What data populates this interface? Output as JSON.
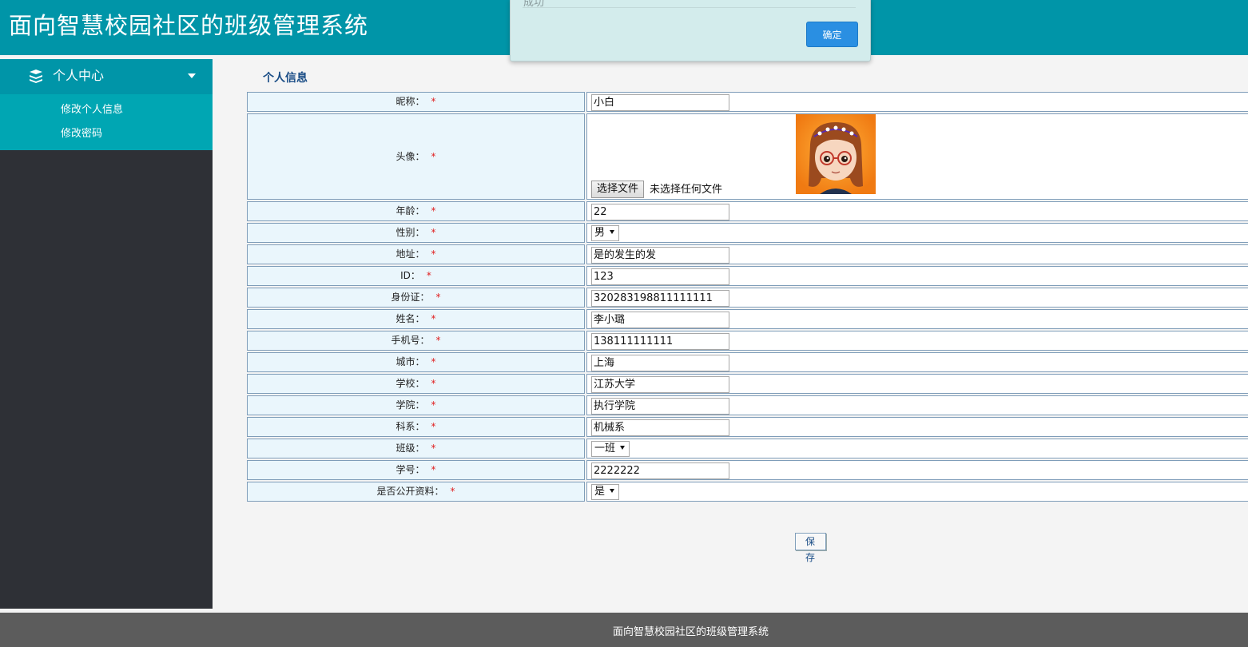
{
  "header": {
    "title": "面向智慧校园社区的班级管理系统"
  },
  "dialog": {
    "message": "成功",
    "ok_label": "确定"
  },
  "sidebar": {
    "menu_title": "个人中心",
    "items": [
      {
        "label": "修改个人信息"
      },
      {
        "label": "修改密码"
      }
    ]
  },
  "main": {
    "section_title": "个人信息",
    "required_mark": "*",
    "fields": {
      "nickname": {
        "label": "昵称：",
        "value": "小白"
      },
      "avatar": {
        "label": "头像：",
        "file_button": "选择文件",
        "file_status": "未选择任何文件"
      },
      "age": {
        "label": "年龄：",
        "value": "22"
      },
      "gender": {
        "label": "性别：",
        "value": "男"
      },
      "address": {
        "label": "地址：",
        "value": "是的发生的发"
      },
      "id": {
        "label": "ID：",
        "value": "123"
      },
      "id_card": {
        "label": "身份证：",
        "value": "320283198811111111"
      },
      "name": {
        "label": "姓名：",
        "value": "李小璐"
      },
      "phone": {
        "label": "手机号：",
        "value": "138111111111"
      },
      "city": {
        "label": "城市：",
        "value": "上海"
      },
      "school": {
        "label": "学校：",
        "value": "江苏大学"
      },
      "college": {
        "label": "学院：",
        "value": "执行学院"
      },
      "department": {
        "label": "科系：",
        "value": "机械系"
      },
      "class": {
        "label": "班级：",
        "value": "一班"
      },
      "student_no": {
        "label": "学号：",
        "value": "2222222"
      },
      "public_profile": {
        "label": "是否公开资料：",
        "value": "是"
      }
    },
    "save_label": "保 存"
  },
  "footer": {
    "text": "面向智慧校园社区的班级管理系统"
  },
  "colors": {
    "header_bg": "#0095a8",
    "sidebar_bg": "#2e3036",
    "submenu_bg": "#00a6b3",
    "label_cell_bg": "#eaf6fc",
    "required": "#e02020",
    "dialog_button": "#2a8fe2",
    "footer_bg": "#5c5c5c"
  },
  "icons": {
    "menu": "stack-icon",
    "caret": "caret-down-icon",
    "select": "dropdown-arrow-icon"
  }
}
